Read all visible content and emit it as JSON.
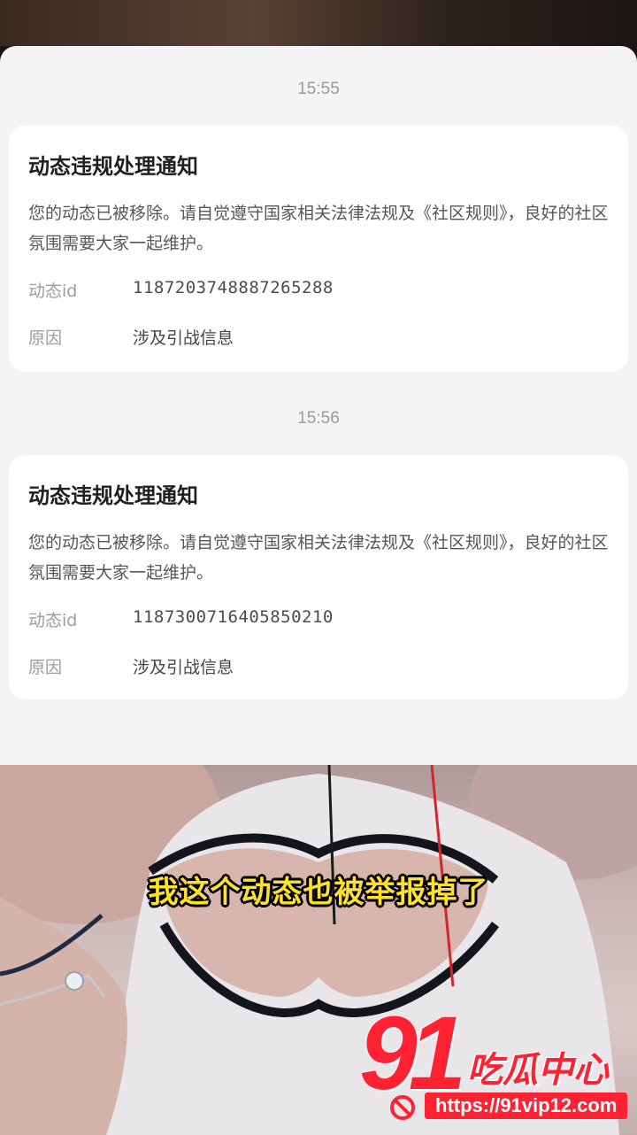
{
  "notices": [
    {
      "time": "15:55",
      "title": "动态违规处理通知",
      "body": "您的动态已被移除。请自觉遵守国家相关法律法规及《社区规则》，良好的社区氛围需要大家一起维护。",
      "id_label": "动态id",
      "id_value": "1187203748887265288",
      "reason_label": "原因",
      "reason_value": "涉及引战信息"
    },
    {
      "time": "15:56",
      "title": "动态违规处理通知",
      "body": "您的动态已被移除。请自觉遵守国家相关法律法规及《社区规则》，良好的社区氛围需要大家一起维护。",
      "id_label": "动态id",
      "id_value": "1187300716405850210",
      "reason_label": "原因",
      "reason_value": "涉及引战信息"
    }
  ],
  "video": {
    "caption": "我这个动态也被举报掉了"
  },
  "watermark": {
    "number": "91",
    "name": "吃瓜中心",
    "url": "https://91vip12.com"
  },
  "colors": {
    "caption": "#ffe12a",
    "watermark": "#ff2233"
  }
}
